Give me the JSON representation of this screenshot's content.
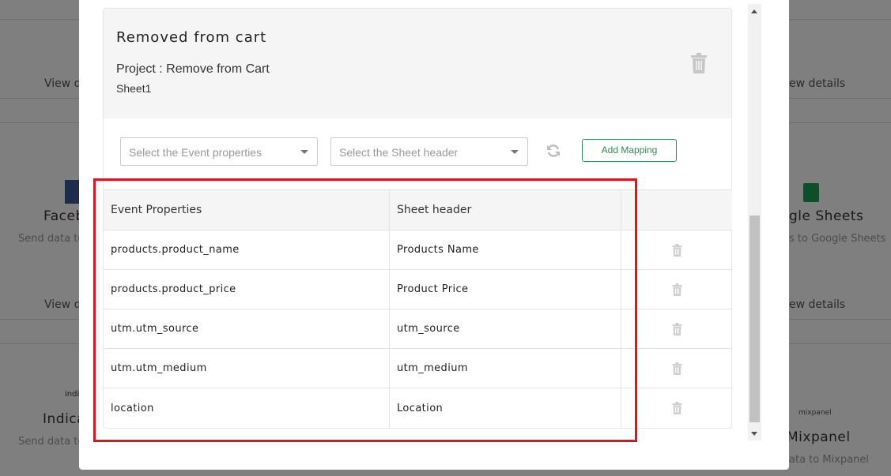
{
  "background": {
    "left_view": "View d",
    "right_view": "ew details",
    "left_title_1": "Faceb",
    "left_sub_1": "Send data to",
    "right_title_1": "gle Sheets",
    "right_sub_1": "s to Google Sheets",
    "left_logo_2": "indic",
    "left_title_2": "Indica",
    "left_sub_2": "Send data to",
    "right_logo_2": "mixpanel",
    "right_title_2": "Mixpanel",
    "right_sub_2": "ata to Mixpanel"
  },
  "card": {
    "title": "Removed from cart",
    "project": "Project : Remove from Cart",
    "sheet": "Sheet1"
  },
  "controls": {
    "event_placeholder": "Select the Event properties",
    "sheet_placeholder": "Select the Sheet header",
    "add_mapping_label": "Add Mapping"
  },
  "table": {
    "headers": [
      "Event Properties",
      "Sheet header",
      ""
    ],
    "rows": [
      {
        "event": "products.product_name",
        "sheet": "Products Name"
      },
      {
        "event": "products.product_price",
        "sheet": "Product Price"
      },
      {
        "event": "utm.utm_source",
        "sheet": "utm_source"
      },
      {
        "event": "utm.utm_medium",
        "sheet": "utm_medium"
      },
      {
        "event": "location",
        "sheet": "Location"
      }
    ]
  },
  "colors": {
    "accent": "#2e8b57",
    "highlight": "#e0141e"
  }
}
